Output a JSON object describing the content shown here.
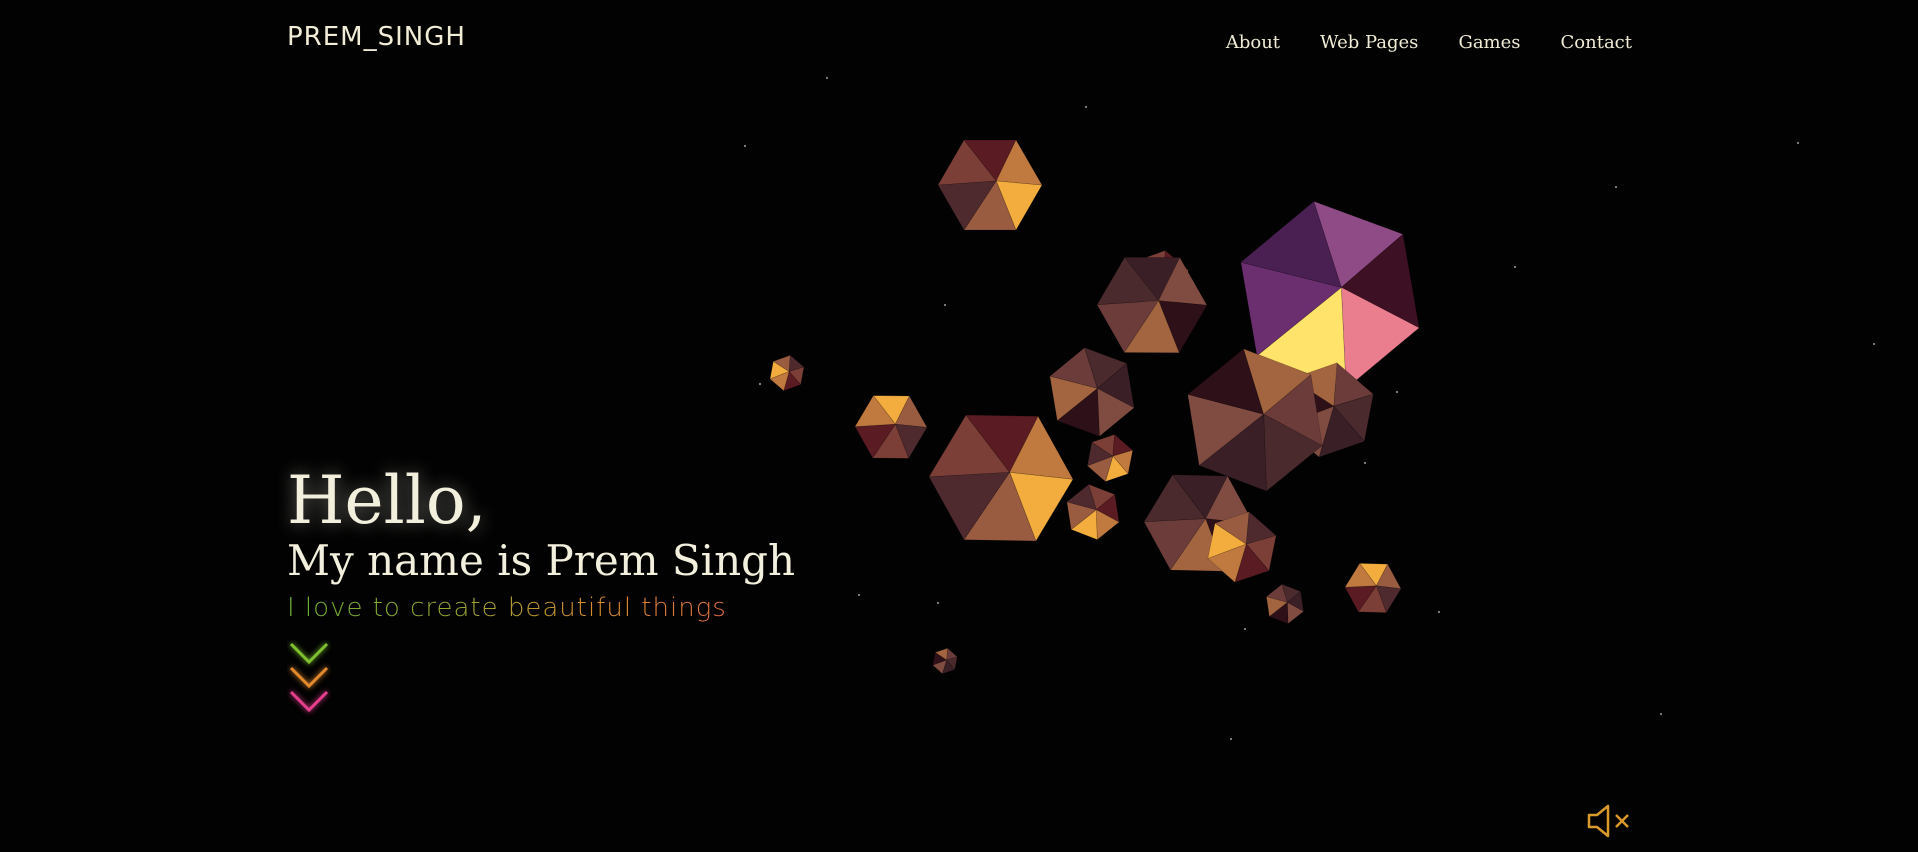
{
  "header": {
    "logo": "PREM_SINGH",
    "nav": [
      "About",
      "Web Pages",
      "Games",
      "Contact"
    ]
  },
  "hero": {
    "greeting": "Hello,",
    "name_line": "My name is Prem Singh",
    "tagline": "I love to create beautiful things"
  },
  "scroll_indicator": {
    "icon": "triple-chevron-down-icon",
    "colors": [
      "#7fc02e",
      "#e38a2c",
      "#e63f8e"
    ]
  },
  "audio": {
    "icon": "speaker-muted-icon",
    "color": "#d99a2a"
  },
  "colors": {
    "background": "#020202",
    "text": "#f2eedc",
    "gem_gold": "#f3b23e",
    "gem_purple": "#6a2f70"
  }
}
